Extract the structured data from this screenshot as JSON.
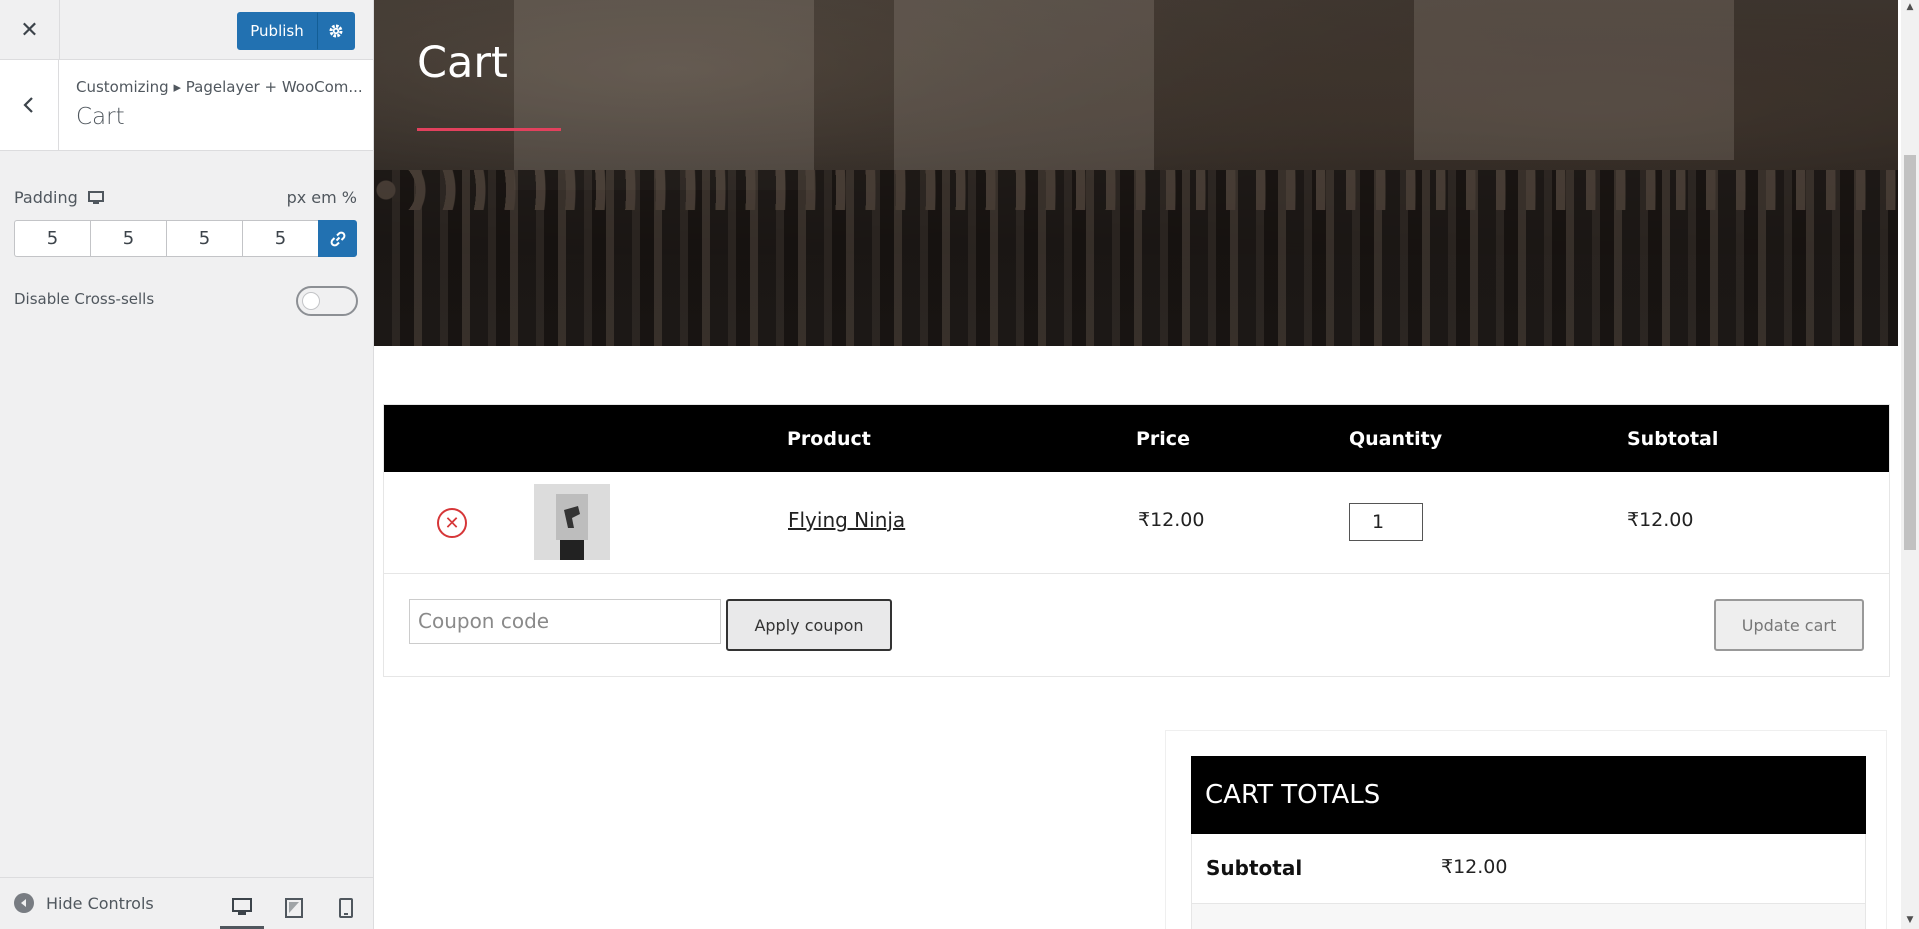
{
  "header": {
    "publish_label": "Publish"
  },
  "section": {
    "breadcrumb": "Customizing ▸ Pagelayer + WooCom...",
    "title": "Cart"
  },
  "controls": {
    "padding_label": "Padding",
    "units": "px em %",
    "padding_values": [
      "5",
      "5",
      "5",
      "5"
    ],
    "cross_sells_label": "Disable Cross-sells",
    "cross_sells_enabled": false
  },
  "footer": {
    "hide_controls_label": "Hide Controls",
    "devices": [
      "desktop",
      "tablet",
      "mobile"
    ],
    "active_device": "desktop"
  },
  "preview": {
    "page_title": "Cart",
    "table_headers": {
      "product": "Product",
      "price": "Price",
      "quantity": "Quantity",
      "subtotal": "Subtotal"
    },
    "item": {
      "name": "Flying Ninja",
      "price": "₹12.00",
      "quantity": "1",
      "subtotal": "₹12.00"
    },
    "coupon_placeholder": "Coupon code",
    "apply_coupon_label": "Apply coupon",
    "update_cart_label": "Update cart",
    "totals": {
      "title": "CART TOTALS",
      "subtotal_label": "Subtotal",
      "subtotal_value": "₹12.00"
    }
  },
  "colors": {
    "accent": "#2271b1",
    "hero_underline": "#e2415d",
    "remove": "#d63638"
  }
}
